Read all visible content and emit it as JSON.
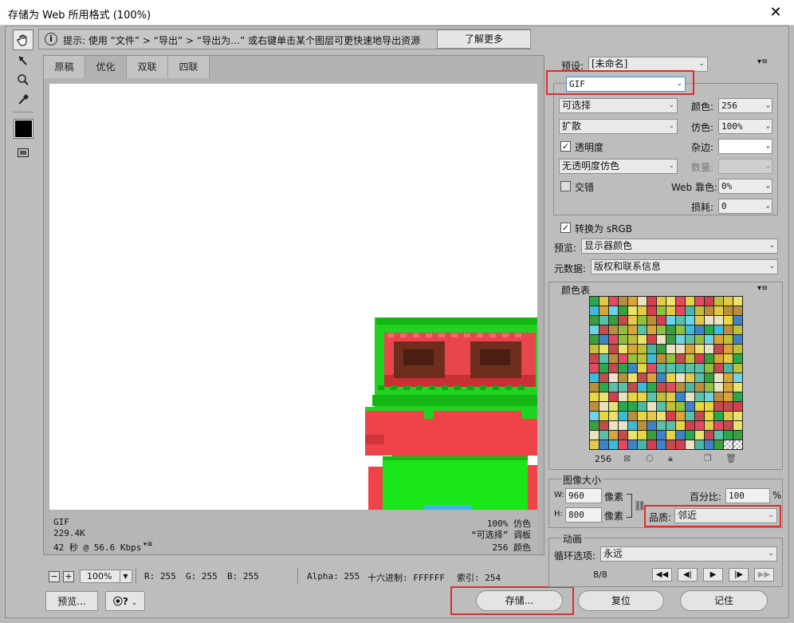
{
  "window": {
    "title": "存储为 Web 所用格式 (100%)",
    "close": "✕"
  },
  "hint": {
    "text": "提示: 使用 “文件” > “导出” > “导出为…” 或右键单击某个图层可更快速地导出资源",
    "learn_more": "了解更多"
  },
  "tabs": [
    {
      "label": "原稿"
    },
    {
      "label": "优化"
    },
    {
      "label": "双联"
    },
    {
      "label": "四联"
    }
  ],
  "image_info": {
    "format": "GIF",
    "size": "229.4K",
    "time": "42 秒 @ 56.6 Kbps",
    "dither": "100% 仿色",
    "palette": "“可选择” 调板",
    "colors": "256 颜色"
  },
  "status": {
    "zoom": "100%",
    "r": "R: 255",
    "g": "G: 255",
    "b": "B: 255",
    "alpha": "Alpha: 255",
    "hex": "十六进制: FFFFFF",
    "index": "索引: 254"
  },
  "buttons": {
    "preview": "预览...",
    "save": "存储...",
    "reset": "复位",
    "remember": "记住"
  },
  "settings": {
    "preset_label": "预设:",
    "preset_value": "[未命名]",
    "format": "GIF",
    "reduction": "可选择",
    "colors_label": "颜色:",
    "colors_value": "256",
    "dither_algo": "扩散",
    "dither_label": "仿色:",
    "dither_value": "100%",
    "transparency_label": "透明度",
    "transparency_checked": true,
    "matte_label": "杂边:",
    "trans_dither": "无透明度仿色",
    "amount_label": "数量:",
    "interlaced_label": "交错",
    "interlaced_checked": false,
    "web_snap_label": "Web 靠色:",
    "web_snap_value": "0%",
    "lossy_label": "损耗:",
    "lossy_value": "0",
    "convert_srgb_label": "转换为 sRGB",
    "convert_srgb_checked": true,
    "preview_label": "预览:",
    "preview_value": "显示器颜色",
    "metadata_label": "元数据:",
    "metadata_value": "版权和联系信息"
  },
  "color_table": {
    "title": "颜色表",
    "count": "256",
    "palette": [
      "#2aa94c",
      "#e7d541",
      "#3bbcd8",
      "#c44b4b",
      "#8fc13f",
      "#d9a53a",
      "#e9e26d",
      "#5ac1a9",
      "#e14b62",
      "#3d83c7",
      "#bfbf3a",
      "#6fd3e6",
      "#b98f3b",
      "#e8e3c2",
      "#3a9f3d",
      "#d43f4f",
      "#e3c94a",
      "#4db6a3"
    ]
  },
  "image_size": {
    "title": "图像大小",
    "w_label": "W:",
    "w_value": "960",
    "h_label": "H:",
    "h_value": "800",
    "unit": "像素",
    "percent_label": "百分比:",
    "percent_value": "100",
    "percent_unit": "%",
    "quality_label": "品质:",
    "quality_value": "邻近"
  },
  "animation": {
    "title": "动画",
    "loop_label": "循环选项:",
    "loop_value": "永远",
    "frame": "8/8"
  }
}
